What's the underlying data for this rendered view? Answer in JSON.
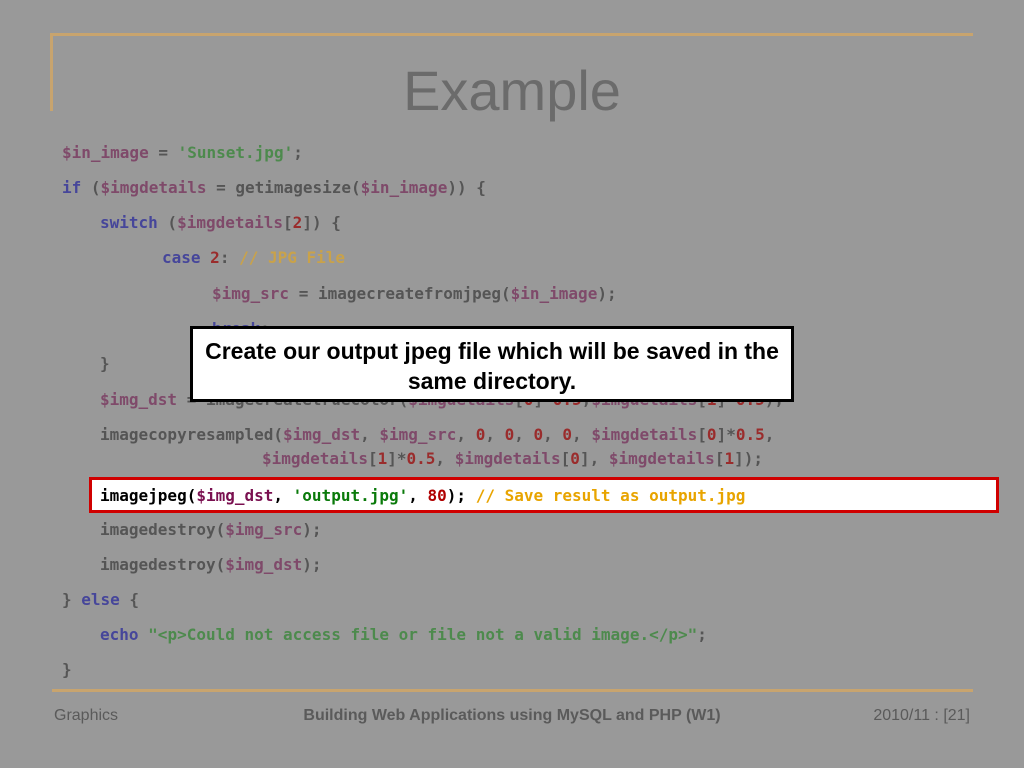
{
  "slide": {
    "title": "Example",
    "callout": "Create our output jpeg file which will be saved in the same directory.",
    "footer": {
      "left": "Graphics",
      "center": "Building Web Applications using MySQL and PHP (W1)",
      "right": "2010/11 : [21]"
    }
  },
  "code": {
    "l1": [
      "$in_image",
      " = ",
      "'Sunset.jpg'",
      ";"
    ],
    "l2": [
      "if",
      " (",
      "$imgdetails",
      " = getimagesize(",
      "$in_image",
      ")) {"
    ],
    "l3": [
      "switch",
      " (",
      "$imgdetails",
      "[",
      "2",
      "]) {"
    ],
    "l4": [
      "case",
      " ",
      "2",
      ": ",
      "// JPG File"
    ],
    "l5": [
      "$img_src",
      " = imagecreatefromjpeg(",
      "$in_image",
      ");"
    ],
    "l6": [
      "break",
      ";"
    ],
    "l7": [
      "}"
    ],
    "l8": [
      "$img_dst",
      " = imagecreatetruecolor(",
      "$imgdetails",
      "[",
      "0",
      "]*",
      "0.5",
      ",",
      "$imgdetails",
      "[",
      "1",
      "]*",
      "0.5",
      ");"
    ],
    "l9": [
      "imagecopyresampled(",
      "$img_dst",
      ", ",
      "$img_src",
      ", ",
      "0",
      ", ",
      "0",
      ", ",
      "0",
      ", ",
      "0",
      ", ",
      "$imgdetails",
      "[",
      "0",
      "]*",
      "0.5",
      ","
    ],
    "l10": [
      "$imgdetails",
      "[",
      "1",
      "]*",
      "0.5",
      ", ",
      "$imgdetails",
      "[",
      "0",
      "], ",
      "$imgdetails",
      "[",
      "1",
      "]);"
    ],
    "l11": [
      "imagejpeg(",
      "$img_dst",
      ", ",
      "'output.jpg'",
      ", ",
      "80",
      "); ",
      "// Save result as output.jpg"
    ],
    "l12": [
      "imagedestroy(",
      "$img_src",
      ");"
    ],
    "l13": [
      "imagedestroy(",
      "$img_dst",
      ");"
    ],
    "l14": [
      "} ",
      "else",
      " {"
    ],
    "l15": [
      "echo",
      " ",
      "\"<p>Could not access file or file not a valid image.</p>\"",
      ";"
    ],
    "l16": [
      "}"
    ]
  }
}
